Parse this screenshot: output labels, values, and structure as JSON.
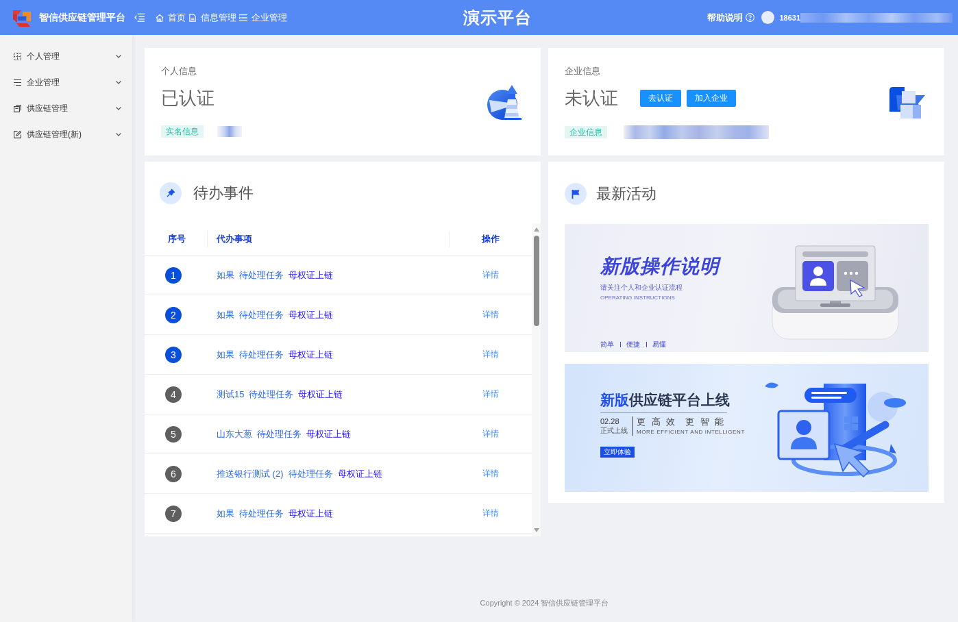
{
  "header": {
    "app_name": "智信供应链管理平台",
    "breadcrumb": [
      {
        "label": "首页",
        "kind": "home"
      },
      {
        "label": "信息管理",
        "kind": "page"
      },
      {
        "label": "企业管理",
        "kind": "list"
      }
    ],
    "title": "演示平台",
    "help": "帮助说明",
    "user": "18631"
  },
  "sidebar": {
    "items": [
      {
        "label": "个人管理",
        "kind": "grid",
        "expanded": false
      },
      {
        "label": "企业管理",
        "kind": "list",
        "expanded": false
      },
      {
        "label": "供应链管理",
        "kind": "copy",
        "expanded": false
      },
      {
        "label": "供应链管理(新)",
        "kind": "edit",
        "expanded": false
      }
    ]
  },
  "personal_info": {
    "label": "个人信息",
    "status": "已认证",
    "tag": "实名信息"
  },
  "company_info": {
    "label": "企业信息",
    "status": "未认证",
    "buttons": [
      "去认证",
      "加入企业"
    ],
    "tag": "企业信息"
  },
  "todo": {
    "title": "待办事件",
    "columns": [
      "序号",
      "代办事项",
      "操作"
    ],
    "rows": [
      {
        "index": "1",
        "color": "#0a4fd8",
        "name": "如果",
        "type": "待处理任务",
        "link": "母权证上链",
        "action": "详情"
      },
      {
        "index": "2",
        "color": "#0a4fd8",
        "name": "如果",
        "type": "待处理任务",
        "link": "母权证上链",
        "action": "详情"
      },
      {
        "index": "3",
        "color": "#0a4fd8",
        "name": "如果",
        "type": "待处理任务",
        "link": "母权证上链",
        "action": "详情"
      },
      {
        "index": "4",
        "color": "#5f5f5f",
        "name": "测试15",
        "type": "待处理任务",
        "link": "母权证上链",
        "action": "详情"
      },
      {
        "index": "5",
        "color": "#5f5f5f",
        "name": "山东大葱",
        "type": "待处理任务",
        "link": "母权证上链",
        "action": "详情"
      },
      {
        "index": "6",
        "color": "#5f5f5f",
        "name": "推送银行测试 (2)",
        "type": "待处理任务",
        "link": "母权证上链",
        "action": "详情"
      },
      {
        "index": "7",
        "color": "#5f5f5f",
        "name": "如果",
        "type": "待处理任务",
        "link": "母权证上链",
        "action": "详情"
      }
    ]
  },
  "activity": {
    "title": "最新活动",
    "banners": [
      {
        "kind": "guide",
        "title": "新版操作说明",
        "subtitle": "请关注个人和企业认证流程",
        "caption": "OPERATING INSTRUCTIONS",
        "tags": [
          "简单",
          "便捷",
          "易懂"
        ]
      },
      {
        "kind": "launch",
        "title_parts": [
          {
            "text": "新版",
            "color": "#1f4fe6"
          },
          {
            "text": "供应链平台上线",
            "color": "#2b3550"
          }
        ],
        "date": "02.28",
        "date_note": "正式上线",
        "slogan": "更 高 效  更 智 能",
        "caption": "MORE EFFICIENT AND INTELLIGENT",
        "button": "立即体验"
      }
    ]
  },
  "footer": "Copyright © 2024 智信供应链管理平台"
}
